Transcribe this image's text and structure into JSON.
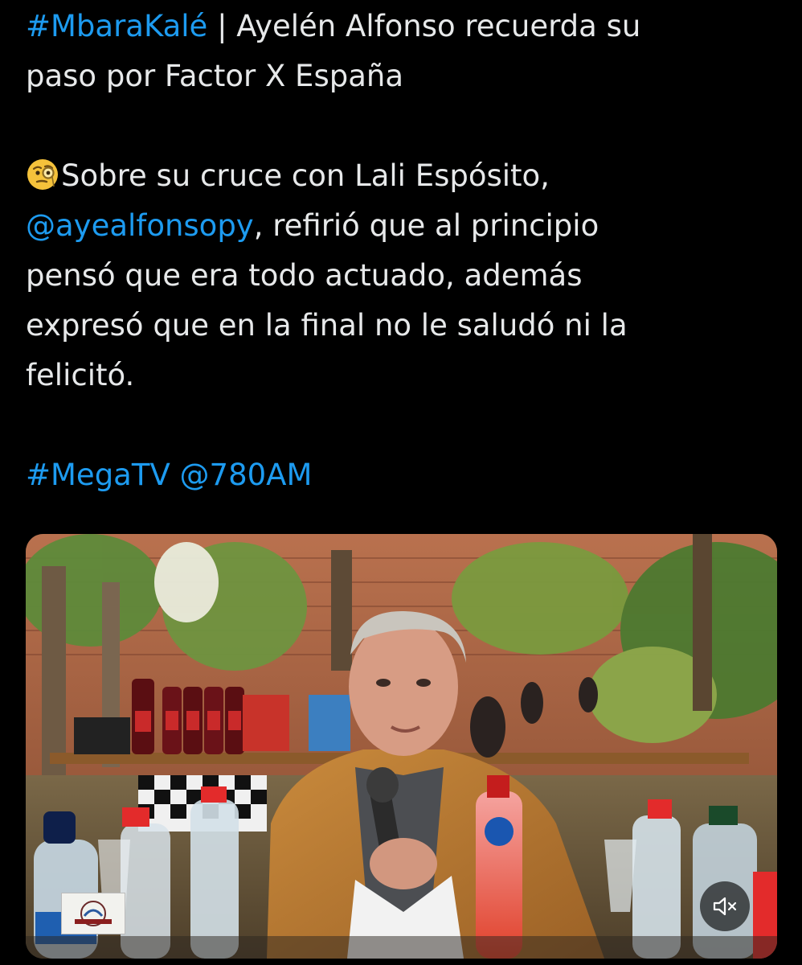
{
  "tweet": {
    "hashtag_mbarakale": "#MbaraKalé",
    "title_rest": " | Ayelén Alfonso recuerda su",
    "title_line2": "paso por Factor X España",
    "emoji": "face-with-monocle",
    "para_line1": "Sobre su cruce con Lali Espósito,",
    "mention_ayealfonsopy": "@ayealfonsopy",
    "para_line2_rest": ", refirió que al principio",
    "para_line3": "pensó que era todo actuado, además",
    "para_line4": "expresó que en la final no le saludó ni la",
    "para_line5": "felicitó.",
    "hashtag_megatv": "#MegaTV",
    "mention_780am": "@780AM"
  },
  "media": {
    "type": "video",
    "description_icon": "video-frame",
    "mute_icon": "speaker-muted-icon"
  },
  "colors": {
    "background": "#000000",
    "text": "#e7e9ea",
    "link": "#1d9bf0"
  }
}
